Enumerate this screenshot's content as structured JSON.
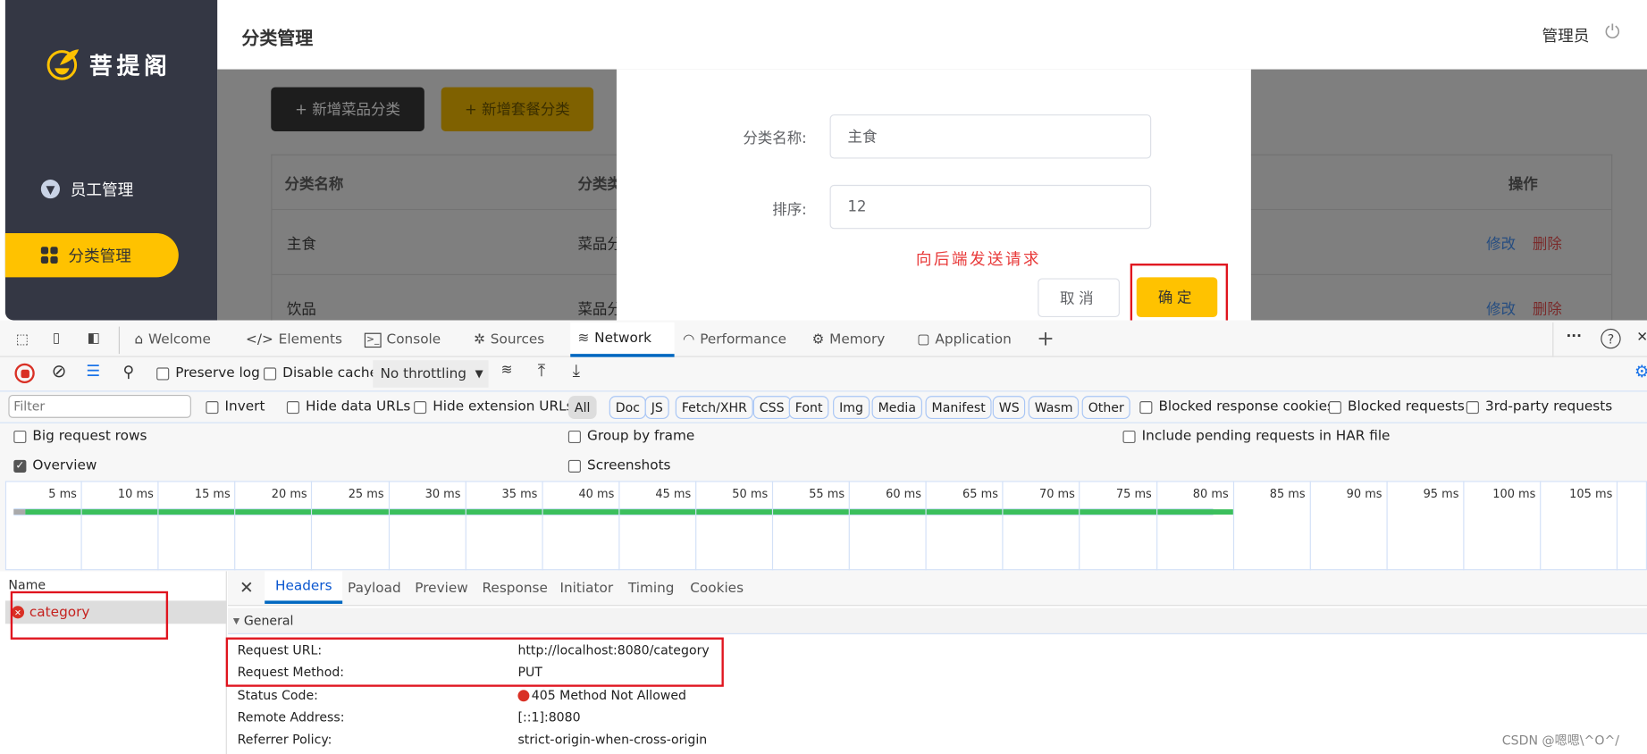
{
  "app": {
    "brand": "菩提阁",
    "page_title": "分类管理",
    "user": "管理员",
    "nav": [
      {
        "label": "员工管理",
        "icon": "employee-icon"
      },
      {
        "label": "分类管理",
        "icon": "category-grid-icon",
        "active": true
      }
    ],
    "buttons": {
      "add_dish_category": "+ 新增菜品分类",
      "add_setmeal_category": "+ 新增套餐分类"
    },
    "table": {
      "headers": [
        "分类名称",
        "分类类",
        "操作"
      ],
      "rows": [
        {
          "name": "主食",
          "type": "菜品分",
          "edit": "修改",
          "delete": "删除"
        },
        {
          "name": "饮品",
          "type": "菜品分",
          "edit": "修改",
          "delete": "删除"
        }
      ]
    },
    "dialog": {
      "name_label": "分类名称:",
      "name_value": "主食",
      "sort_label": "排序:",
      "sort_value": "12",
      "annotation": "向后端发送请求",
      "cancel": "取消",
      "confirm": "确定"
    },
    "colors": {
      "accent": "#ffc200",
      "sidebar": "#343744",
      "annotation_red": "#e0141e"
    }
  },
  "devtools": {
    "tabs": [
      {
        "label": "Welcome",
        "icon": "home-icon"
      },
      {
        "label": "Elements",
        "icon": "code-icon"
      },
      {
        "label": "Console",
        "icon": "console-icon"
      },
      {
        "label": "Sources",
        "icon": "bug-icon"
      },
      {
        "label": "Network",
        "icon": "wifi-icon",
        "active": true
      },
      {
        "label": "Performance",
        "icon": "gauge-icon"
      },
      {
        "label": "Memory",
        "icon": "chip-icon"
      },
      {
        "label": "Application",
        "icon": "app-window-icon"
      }
    ],
    "toolbar": {
      "preserve_log": "Preserve log",
      "disable_cache": "Disable cache",
      "throttling": "No throttling"
    },
    "filter": {
      "placeholder": "Filter",
      "invert": "Invert",
      "hide_data_urls": "Hide data URLs",
      "hide_extension_urls": "Hide extension URLs",
      "types": [
        "All",
        "Doc",
        "JS",
        "Fetch/XHR",
        "CSS",
        "Font",
        "Img",
        "Media",
        "Manifest",
        "WS",
        "Wasm",
        "Other"
      ],
      "blocked_cookies": "Blocked response cookies",
      "blocked_requests": "Blocked requests",
      "third_party": "3rd-party requests"
    },
    "settings": {
      "big_rows": "Big request rows",
      "group_by_frame": "Group by frame",
      "include_pending": "Include pending requests in HAR file",
      "overview": "Overview",
      "overview_checked": true,
      "screenshots": "Screenshots"
    },
    "timeline": {
      "ticks": [
        "5 ms",
        "10 ms",
        "15 ms",
        "20 ms",
        "25 ms",
        "30 ms",
        "35 ms",
        "40 ms",
        "45 ms",
        "50 ms",
        "55 ms",
        "60 ms",
        "65 ms",
        "70 ms",
        "75 ms",
        "80 ms",
        "85 ms",
        "90 ms",
        "95 ms",
        "100 ms",
        "105 ms"
      ],
      "request_end_ms": 80
    },
    "requests": {
      "header": "Name",
      "items": [
        {
          "name": "category",
          "status": "error"
        }
      ]
    },
    "detail_tabs": [
      "Headers",
      "Payload",
      "Preview",
      "Response",
      "Initiator",
      "Timing",
      "Cookies"
    ],
    "general": {
      "title": "General",
      "rows": [
        {
          "label": "Request URL:",
          "value": "http://localhost:8080/category"
        },
        {
          "label": "Request Method:",
          "value": "PUT"
        },
        {
          "label": "Status Code:",
          "value": "405 Method Not Allowed"
        },
        {
          "label": "Remote Address:",
          "value": "[::1]:8080"
        },
        {
          "label": "Referrer Policy:",
          "value": "strict-origin-when-cross-origin"
        }
      ]
    }
  },
  "watermark": "CSDN @嗯嗯\\^O^/"
}
